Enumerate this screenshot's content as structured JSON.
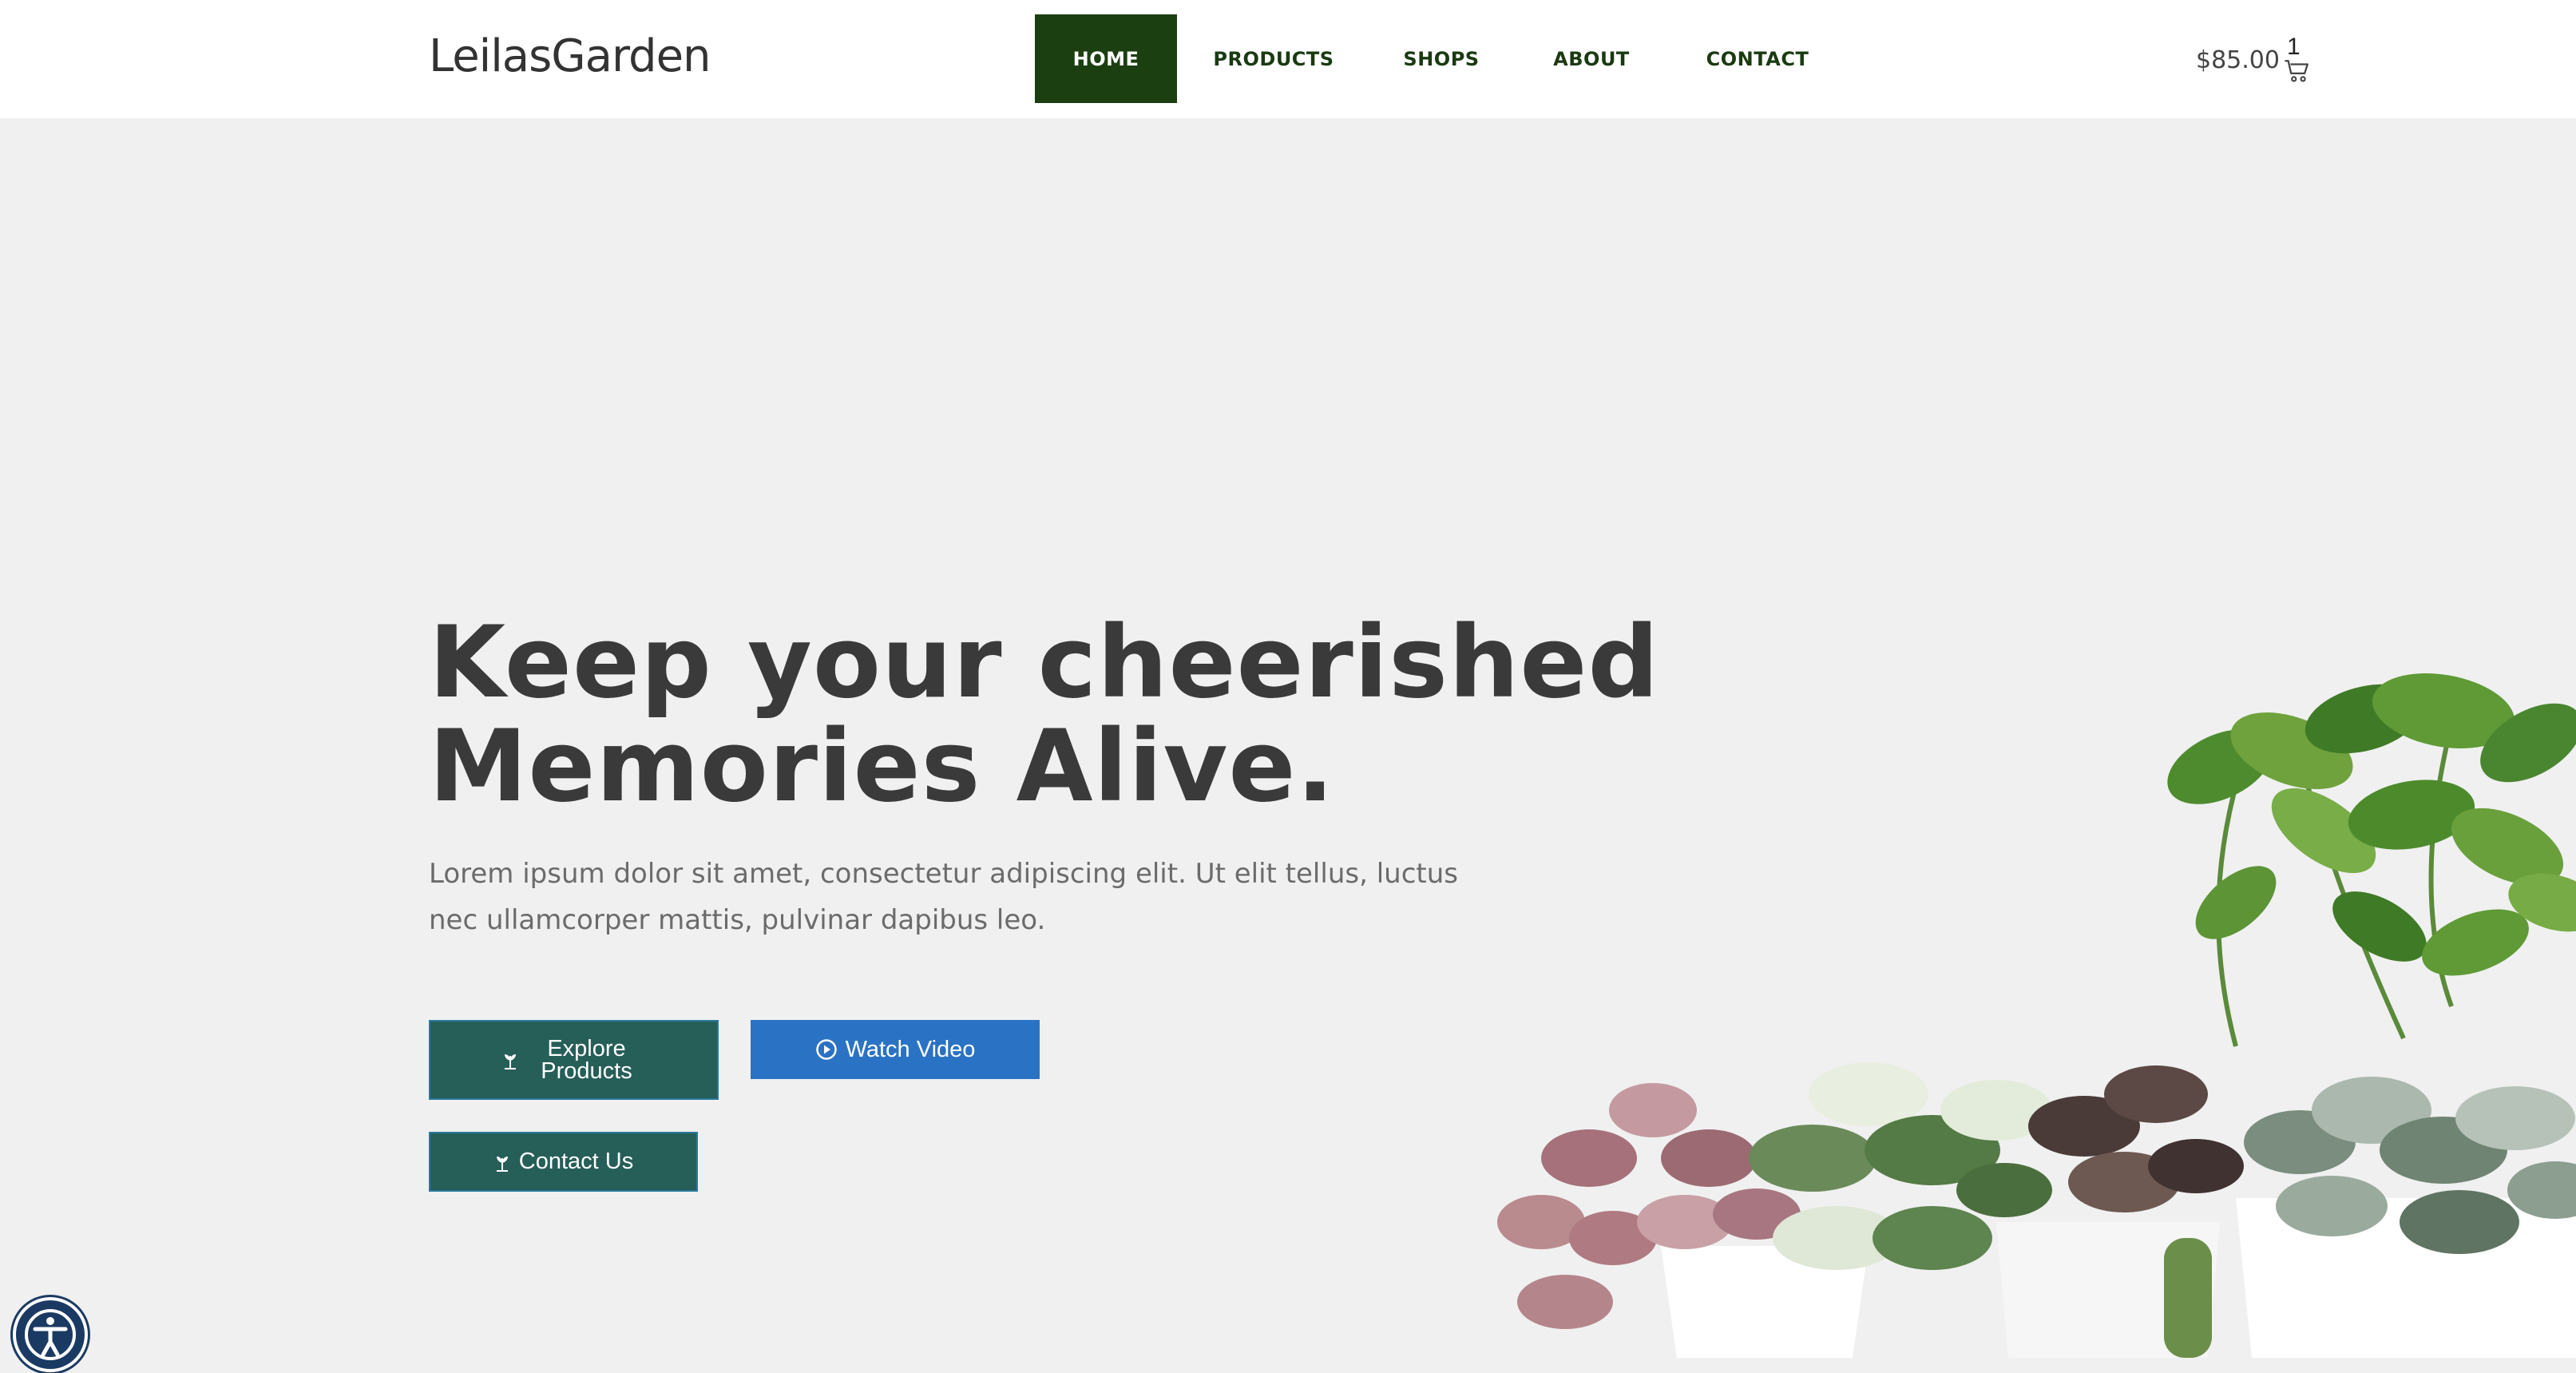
{
  "brand": {
    "name": "LeilasGarden"
  },
  "nav": {
    "items": [
      {
        "label": "HOME",
        "active": true
      },
      {
        "label": "PRODUCTS",
        "active": false
      },
      {
        "label": "SHOPS",
        "active": false
      },
      {
        "label": "ABOUT",
        "active": false
      },
      {
        "label": "CONTACT",
        "active": false
      }
    ]
  },
  "cart": {
    "total": "$85.00",
    "count": "1",
    "icon": "cart-icon"
  },
  "hero": {
    "headline_line1": "Keep your cheerished",
    "headline_line2": "Memories Alive.",
    "lead": "Lorem ipsum dolor sit amet, consectetur adipiscing elit. Ut elit tellus, luctus nec ullamcorper mattis, pulvinar dapibus leo.",
    "buttons": {
      "explore_label": "Explore Products",
      "explore_icon": "plant-icon",
      "video_label": "Watch Video",
      "video_icon": "play-circle-icon",
      "contact_label": "Contact Us",
      "contact_icon": "plant-icon"
    }
  },
  "accessibility": {
    "icon": "accessibility-icon"
  },
  "colors": {
    "nav_active_bg": "#1c3f12",
    "nav_text": "#1a3a12",
    "primary_teal": "#265e58",
    "video_blue": "#2a72c4",
    "page_bg": "#f0f0f0"
  }
}
